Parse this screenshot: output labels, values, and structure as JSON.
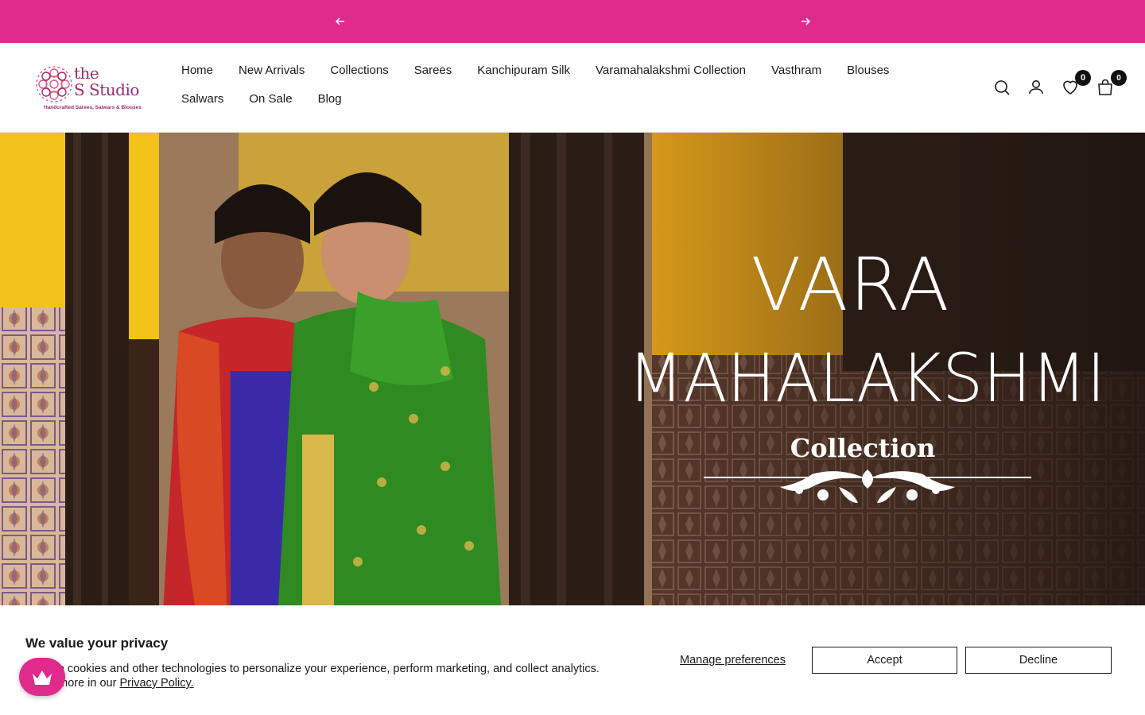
{
  "announcement": {
    "message": "",
    "prev_icon": "arrow-left-icon",
    "next_icon": "arrow-right-icon",
    "bg_color": "#e02b8d"
  },
  "brand": {
    "name_line1": "the",
    "name_line2": "S Studio",
    "tagline": "Handcrafted Sarees, Salwars & Blouses",
    "color": "#9a2d73"
  },
  "nav": {
    "items": [
      "Home",
      "New Arrivals",
      "Collections",
      "Sarees",
      "Kanchipuram Silk",
      "Varamahalakshmi Collection",
      "Vasthram",
      "Blouses",
      "Salwars",
      "On Sale",
      "Blog"
    ]
  },
  "header_icons": {
    "search": "search-icon",
    "account": "user-icon",
    "wishlist": "heart-icon",
    "cart": "shopping-bag-icon",
    "wishlist_count": "0",
    "cart_count": "0"
  },
  "hero": {
    "line1": "VARA",
    "line2": "MAHALAKSHMI",
    "line3": "Collection"
  },
  "privacy": {
    "title": "We value your privacy",
    "text": "We use cookies and other technologies to personalize your experience, perform marketing, and collect analytics. Learn more in our",
    "link": "Privacy Policy.",
    "manage": "Manage preferences",
    "accept": "Accept",
    "decline": "Decline"
  },
  "floating_button": {
    "icon": "crown-icon",
    "color": "#e02b8d"
  }
}
